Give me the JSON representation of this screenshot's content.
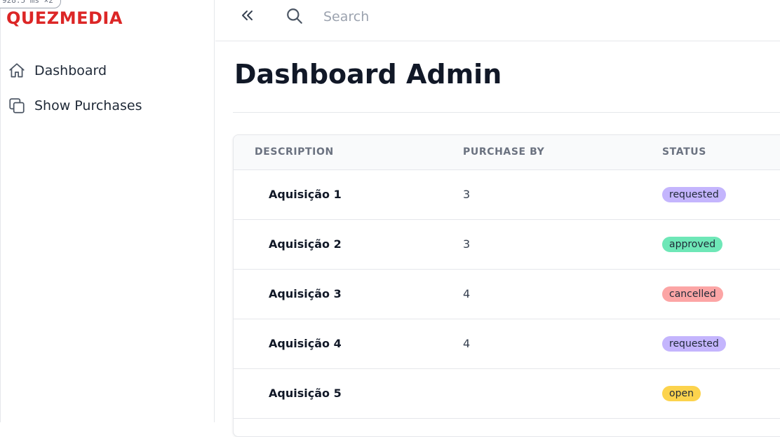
{
  "debug_badge": "928.5 ms ×2",
  "brand": "QUEZMEDIA",
  "sidebar": {
    "items": [
      {
        "label": "Dashboard",
        "icon": "home-icon"
      },
      {
        "label": "Show Purchases",
        "icon": "copy-icon"
      }
    ]
  },
  "topbar": {
    "collapse_icon": "chevrons-left-icon",
    "search_icon": "search-icon",
    "search_placeholder": "Search",
    "search_value": ""
  },
  "page_title": "Dashboard Admin",
  "table": {
    "headers": [
      "DESCRIPTION",
      "PURCHASE BY",
      "STATUS"
    ],
    "rows": [
      {
        "description": "Aquisição 1",
        "purchase_by": "3",
        "status": "requested"
      },
      {
        "description": "Aquisição 2",
        "purchase_by": "3",
        "status": "approved"
      },
      {
        "description": "Aquisição 3",
        "purchase_by": "4",
        "status": "cancelled"
      },
      {
        "description": "Aquisição 4",
        "purchase_by": "4",
        "status": "requested"
      },
      {
        "description": "Aquisição 5",
        "purchase_by": "",
        "status": "open"
      }
    ]
  },
  "status_colors": {
    "requested": "#c4b5fd",
    "approved": "#6ee7b7",
    "cancelled": "#fca5a5",
    "open": "#fcd34d"
  },
  "colors": {
    "brand": "#dc2626"
  }
}
